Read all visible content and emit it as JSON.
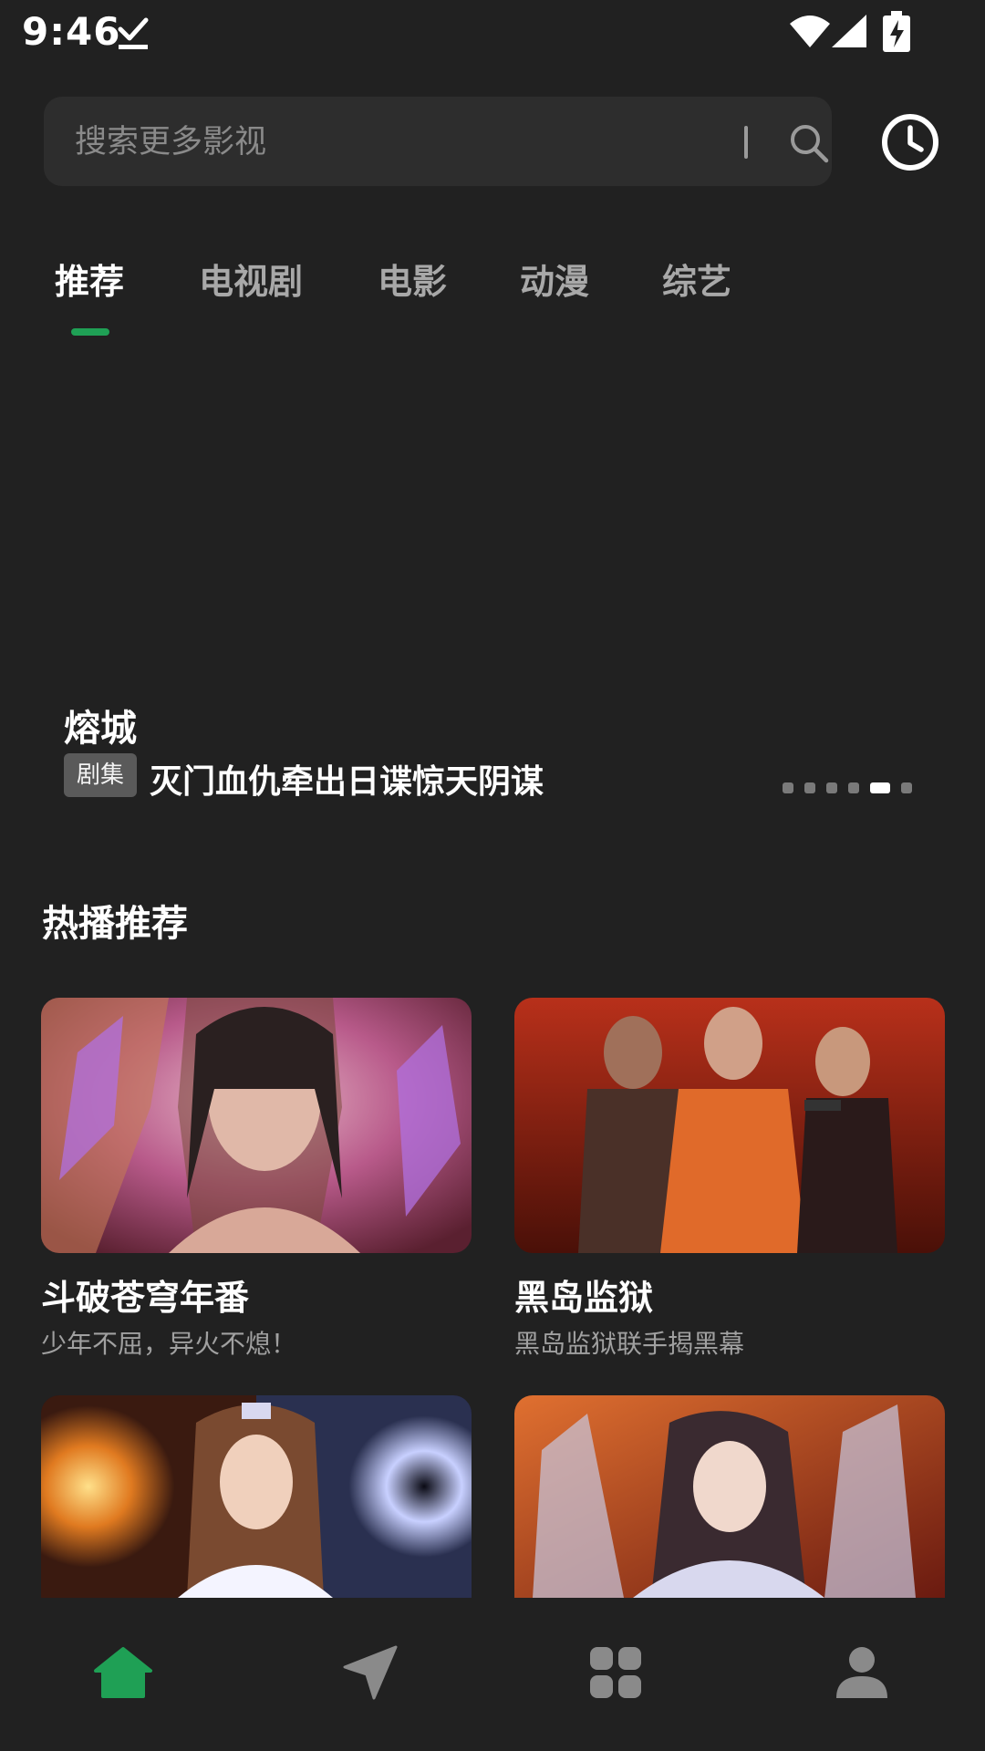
{
  "status_bar": {
    "time": "9:46"
  },
  "search": {
    "placeholder": "搜索更多影视"
  },
  "tabs": [
    {
      "label": "推荐",
      "active": true
    },
    {
      "label": "电视剧",
      "active": false
    },
    {
      "label": "电影",
      "active": false
    },
    {
      "label": "动漫",
      "active": false
    },
    {
      "label": "综艺",
      "active": false
    }
  ],
  "banner": {
    "title": "熔城",
    "badge": "剧集",
    "description": "灭门血仇牵出日谍惊天阴谋",
    "page_count": 6,
    "active_index": 4
  },
  "section": {
    "title": "热播推荐"
  },
  "cards": [
    {
      "title": "斗破苍穹年番",
      "subtitle": "少年不屈，异火不熄！"
    },
    {
      "title": "黑岛监狱",
      "subtitle": "黑岛监狱联手揭黑幕"
    },
    {
      "title": "",
      "subtitle": ""
    },
    {
      "title": "",
      "subtitle": ""
    }
  ],
  "bottom_nav": [
    {
      "icon": "home-icon",
      "active": true
    },
    {
      "icon": "send-icon",
      "active": false
    },
    {
      "icon": "apps-icon",
      "active": false
    },
    {
      "icon": "profile-icon",
      "active": false
    }
  ],
  "colors": {
    "accent": "#1fa055",
    "background": "#212121",
    "search_bg": "#2d2d2d"
  }
}
